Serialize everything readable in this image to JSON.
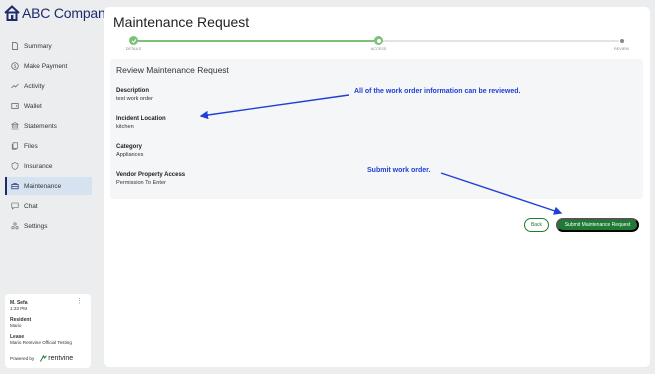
{
  "app": {
    "logo_text": "ABC Company"
  },
  "sidebar": {
    "items": [
      {
        "label": "Summary",
        "icon": "document-icon"
      },
      {
        "label": "Make Payment",
        "icon": "dollar-circle-icon"
      },
      {
        "label": "Activity",
        "icon": "trend-line-icon"
      },
      {
        "label": "Wallet",
        "icon": "wallet-icon"
      },
      {
        "label": "Statements",
        "icon": "bank-icon"
      },
      {
        "label": "Files",
        "icon": "files-icon"
      },
      {
        "label": "Insurance",
        "icon": "shield-icon"
      },
      {
        "label": "Maintenance",
        "icon": "toolbox-icon",
        "active": true
      },
      {
        "label": "Chat",
        "icon": "chat-icon"
      },
      {
        "label": "Settings",
        "icon": "settings-icon"
      }
    ]
  },
  "user_card": {
    "name": "M. Sefa",
    "time": "1:23 PM",
    "resident_label": "Resident",
    "resident_value": "Mario",
    "lease_label": "Lease",
    "lease_value": "Mario Rentvine Official Testing",
    "powered_by": "Powered by",
    "brand": "rentvine"
  },
  "main": {
    "title": "Maintenance Request",
    "steps": [
      {
        "label": "DETAILS",
        "state": "done"
      },
      {
        "label": "ACCESS",
        "state": "current"
      },
      {
        "label": "REVIEW",
        "state": "upcoming"
      }
    ],
    "review": {
      "title": "Review Maintenance Request",
      "fields": [
        {
          "label": "Description",
          "value": "test work order"
        },
        {
          "label": "Incident Location",
          "value": "kitchen"
        },
        {
          "label": "Category",
          "value": "Appliances"
        },
        {
          "label": "Vendor Property Access",
          "value": "Permission To Enter"
        }
      ]
    },
    "buttons": {
      "back": "Back",
      "submit": "Submit Maintenance Request"
    }
  },
  "annotations": {
    "review_note": "All of the work order information can be reviewed.",
    "submit_note": "Submit work order."
  },
  "colors": {
    "accent_green": "#1e7a35",
    "step_green": "#7cc07a",
    "annotation_blue": "#1f3fd6",
    "nav_active_bg": "#d6e2f0",
    "brand_navy": "#1d2b6b"
  }
}
